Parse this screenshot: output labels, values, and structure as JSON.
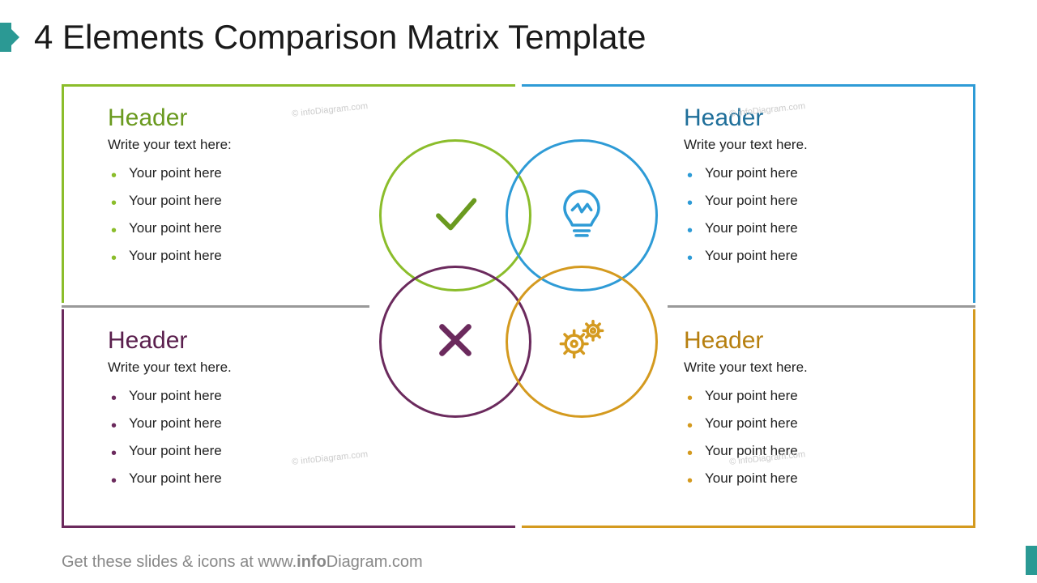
{
  "title": "4 Elements Comparison Matrix Template",
  "footer": {
    "prefix": "Get these slides & icons at www.",
    "brand1": "info",
    "brand2": "Diagram",
    "suffix": ".com"
  },
  "watermark": "© infoDiagram.com",
  "colors": {
    "green": "#8bbd2b",
    "blue": "#2e9bd6",
    "purple": "#6b2a5d",
    "orange": "#d49a1f",
    "greenHeader": "#6a9a1f",
    "blueHeader": "#1f6f9a",
    "purpleHeader": "#5a1f4d",
    "orangeHeader": "#b67f0f"
  },
  "quadrants": [
    {
      "key": "tl",
      "color": "#8bbd2b",
      "headerColor": "#6a9a1f",
      "header": "Header",
      "sub": "Write your text here:",
      "points": [
        "Your point here",
        "Your point here",
        "Your point here",
        "Your point here"
      ],
      "icon": "check"
    },
    {
      "key": "tr",
      "color": "#2e9bd6",
      "headerColor": "#1f6f9a",
      "header": "Header",
      "sub": "Write your text here.",
      "points": [
        "Your point here",
        "Your point here",
        "Your point here",
        "Your point here"
      ],
      "icon": "bulb"
    },
    {
      "key": "bl",
      "color": "#6b2a5d",
      "headerColor": "#5a1f4d",
      "header": "Header",
      "sub": "Write your text here.",
      "points": [
        "Your point here",
        "Your point here",
        "Your point here",
        "Your point here"
      ],
      "icon": "cross"
    },
    {
      "key": "br",
      "color": "#d49a1f",
      "headerColor": "#b67f0f",
      "header": "Header",
      "sub": "Write your text here.",
      "points": [
        "Your point here",
        "Your point here",
        "Your point here",
        "Your point here"
      ],
      "icon": "gears"
    }
  ]
}
